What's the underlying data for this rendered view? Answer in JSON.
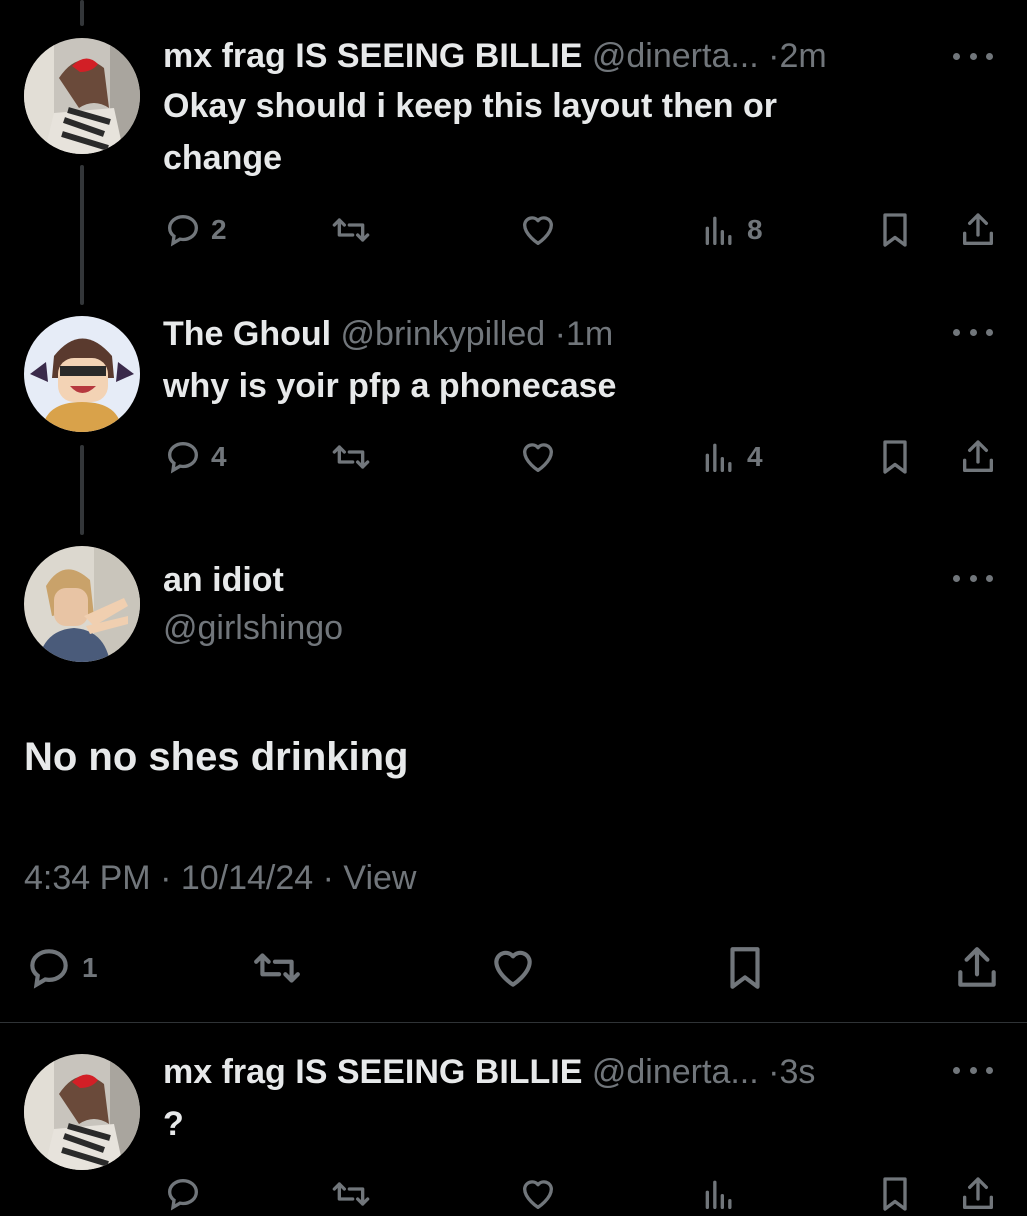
{
  "replies": [
    {
      "name": "mx frag IS SEEING BILLIE",
      "handle": "@dinerta...",
      "dot": "·",
      "time": "2m",
      "text": "Okay should i keep this layout then or change",
      "replies": "2",
      "views": "8"
    },
    {
      "name": "The Ghoul",
      "handle": "@brinkypilled",
      "dot": "·",
      "time": "1m",
      "text": "why is yoir pfp a phonecase",
      "replies": "4",
      "views": "4"
    }
  ],
  "focused": {
    "name": "an idiot",
    "handle": "@girlshingo",
    "text": "No no shes drinking",
    "timestamp": "4:34 PM · 10/14/24 ·",
    "view_label": "View",
    "replies": "1"
  },
  "bottom_reply": {
    "name": "mx frag IS SEEING BILLIE",
    "handle": "@dinerta...",
    "dot": "·",
    "time": "3s",
    "text": "?"
  },
  "colors": {
    "background": "#000000",
    "text": "#e7e9ea",
    "muted": "#71767b",
    "line": "#333639"
  }
}
